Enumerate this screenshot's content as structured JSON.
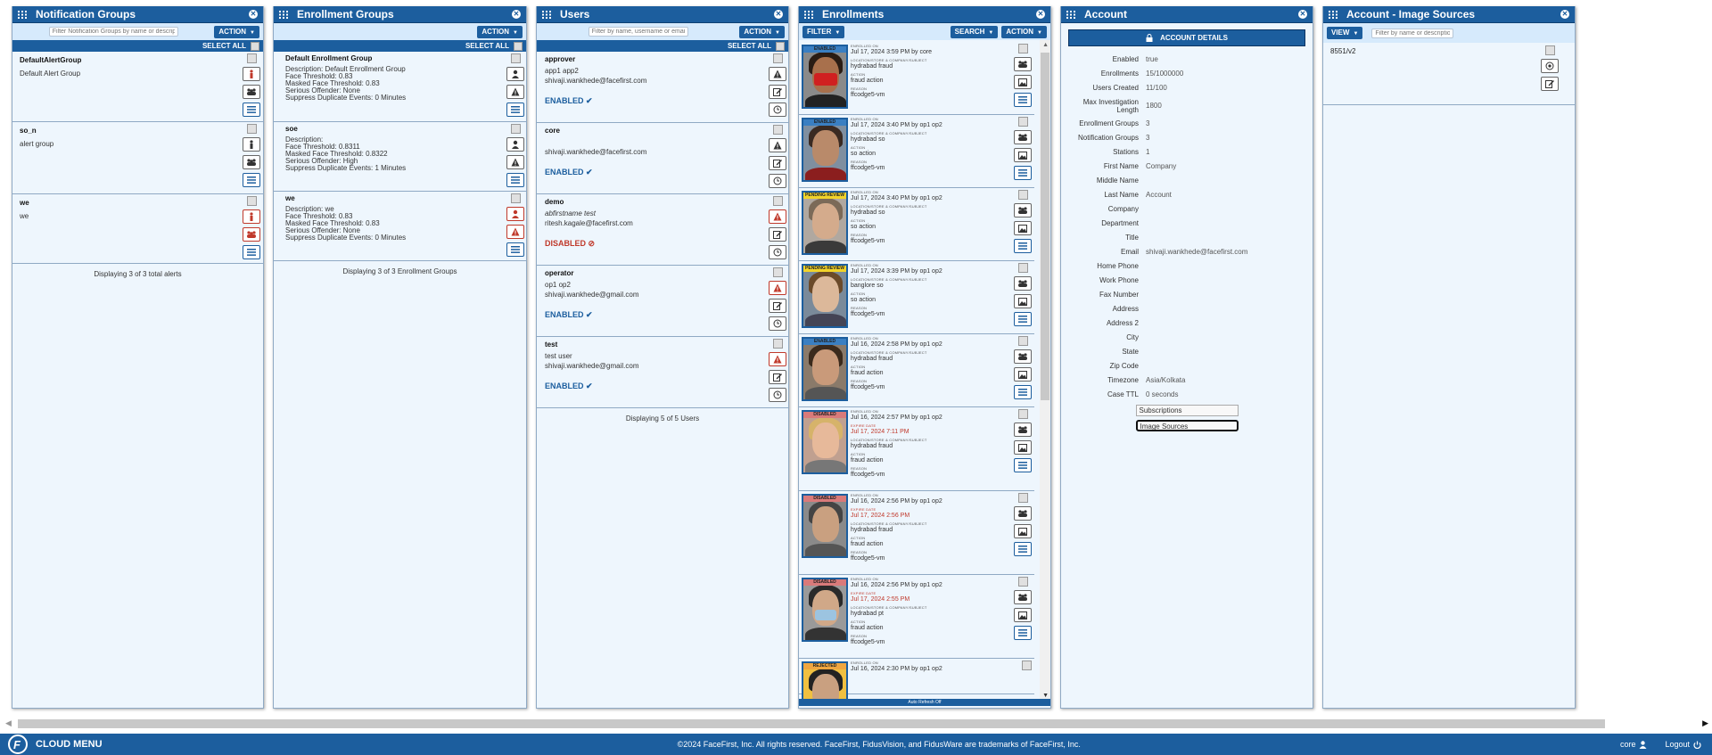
{
  "panels": {
    "notification_groups": {
      "title": "Notification Groups",
      "filter_placeholder": "Filter Notification Groups by name or description",
      "action_label": "ACTION",
      "select_all": "SELECT ALL",
      "items": [
        {
          "name": "DefaultAlertGroup",
          "desc": "Default Alert Group"
        },
        {
          "name": "so_n",
          "desc": "alert group"
        },
        {
          "name": "we",
          "desc": "we"
        }
      ],
      "footer": "Displaying 3 of 3 total alerts"
    },
    "enrollment_groups": {
      "title": "Enrollment Groups",
      "action_label": "ACTION",
      "select_all": "SELECT ALL",
      "items": [
        {
          "name": "Default Enrollment Group",
          "lines": [
            "Description: Default Enrollment Group",
            "Face Threshold: 0.83",
            "Masked Face Threshold: 0.83",
            "Serious Offender: None",
            "Suppress Duplicate Events: 0 Minutes"
          ]
        },
        {
          "name": "soe",
          "lines": [
            "Description:",
            "Face Threshold: 0.8311",
            "Masked Face Threshold: 0.8322",
            "Serious Offender: High",
            "Suppress Duplicate Events: 1 Minutes"
          ]
        },
        {
          "name": "we",
          "lines": [
            "Description: we",
            "Face Threshold: 0.83",
            "Masked Face Threshold: 0.83",
            "Serious Offender: None",
            "Suppress Duplicate Events: 0 Minutes"
          ]
        }
      ],
      "footer": "Displaying 3 of 3 Enrollment Groups"
    },
    "users": {
      "title": "Users",
      "filter_placeholder": "Filter by name, username or email",
      "action_label": "ACTION",
      "select_all": "SELECT ALL",
      "items": [
        {
          "name": "approver",
          "full": "app1 app2",
          "email": "shivaji.wankhede@facefirst.com",
          "status": "ENABLED ✔"
        },
        {
          "name": "core",
          "full": "",
          "email": "shivaji.wankhede@facefirst.com",
          "status": "ENABLED ✔"
        },
        {
          "name": "demo",
          "full": "abfirstname test",
          "email": "ritesh.kagale@facefirst.com",
          "status": "DISABLED ⊘"
        },
        {
          "name": "operator",
          "full": "op1 op2",
          "email": "shivaji.wankhede@gmail.com",
          "status": "ENABLED ✔"
        },
        {
          "name": "test",
          "full": "test user",
          "email": "shivaji.wankhede@gmail.com",
          "status": "ENABLED ✔"
        }
      ],
      "footer": "Displaying 5 of 5 Users"
    },
    "enrollments": {
      "title": "Enrollments",
      "filter_label": "FILTER",
      "search_label": "SEARCH",
      "action_label": "ACTION",
      "label_enrolled": "ENROLLED ON",
      "label_expire": "EXPIRE DATE",
      "label_location": "LOCATION/STORE & COMPANY/SUBJECT",
      "label_action": "ACTION",
      "label_reason": "REASON",
      "auto_refresh": "Auto Refresh Off",
      "items": [
        {
          "status": "ENABLED",
          "enrolled": "Jul 17, 2024 3:59 PM by core",
          "expire": "",
          "location": "hydrabad fraud",
          "action": "fraud action",
          "reason": "ffcodge5-vm"
        },
        {
          "status": "ENABLED",
          "enrolled": "Jul 17, 2024 3:40 PM by op1 op2",
          "expire": "",
          "location": "hydrabad so",
          "action": "so action",
          "reason": "ffcodge5-vm"
        },
        {
          "status": "PENDING REVIEW",
          "enrolled": "Jul 17, 2024 3:40 PM by op1 op2",
          "expire": "",
          "location": "hydrabad so",
          "action": "so action",
          "reason": "ffcodge5-vm"
        },
        {
          "status": "PENDING REVIEW",
          "enrolled": "Jul 17, 2024 3:39 PM by op1 op2",
          "expire": "",
          "location": "banglore so",
          "action": "so action",
          "reason": "ffcodge5-vm"
        },
        {
          "status": "ENABLED",
          "enrolled": "Jul 16, 2024 2:58 PM by op1 op2",
          "expire": "",
          "location": "hydrabad fraud",
          "action": "fraud action",
          "reason": "ffcodge5-vm"
        },
        {
          "status": "DISABLED",
          "enrolled": "Jul 16, 2024 2:57 PM by op1 op2",
          "expire": "Jul 17, 2024 7:11 PM",
          "location": "hydrabad fraud",
          "action": "fraud action",
          "reason": "ffcodge5-vm"
        },
        {
          "status": "DISABLED",
          "enrolled": "Jul 16, 2024 2:56 PM by op1 op2",
          "expire": "Jul 17, 2024 2:56 PM",
          "location": "hydrabad fraud",
          "action": "fraud action",
          "reason": "ffcodge5-vm"
        },
        {
          "status": "DISABLED",
          "enrolled": "Jul 16, 2024 2:56 PM by op1 op2",
          "expire": "Jul 17, 2024 2:55 PM",
          "location": "hydrabad pt",
          "action": "fraud action",
          "reason": "ffcodge5-vm"
        },
        {
          "status": "REJECTED",
          "enrolled": "Jul 16, 2024 2:30 PM by op1 op2",
          "expire": "",
          "location": "",
          "action": "",
          "reason": ""
        }
      ]
    },
    "account": {
      "title": "Account",
      "details_button": "ACCOUNT DETAILS",
      "fields": [
        {
          "k": "Enabled",
          "v": "true"
        },
        {
          "k": "Enrollments",
          "v": "15/1000000"
        },
        {
          "k": "Users Created",
          "v": "11/100"
        },
        {
          "k": "Max Investigation Length",
          "v": "1800"
        },
        {
          "k": "Enrollment Groups",
          "v": "3"
        },
        {
          "k": "Notification Groups",
          "v": "3"
        },
        {
          "k": "Stations",
          "v": "1"
        },
        {
          "k": "First Name",
          "v": "Company"
        },
        {
          "k": "Middle Name",
          "v": ""
        },
        {
          "k": "Last Name",
          "v": "Account"
        },
        {
          "k": "Company",
          "v": ""
        },
        {
          "k": "Department",
          "v": ""
        },
        {
          "k": "Title",
          "v": ""
        },
        {
          "k": "Email",
          "v": "shivaji.wankhede@facefirst.com"
        },
        {
          "k": "Home Phone",
          "v": ""
        },
        {
          "k": "Work Phone",
          "v": ""
        },
        {
          "k": "Fax Number",
          "v": ""
        },
        {
          "k": "Address",
          "v": ""
        },
        {
          "k": "Address 2",
          "v": ""
        },
        {
          "k": "City",
          "v": ""
        },
        {
          "k": "State",
          "v": ""
        },
        {
          "k": "Zip Code",
          "v": ""
        },
        {
          "k": "Timezone",
          "v": "Asia/Kolkata"
        },
        {
          "k": "Case TTL",
          "v": "0 seconds"
        }
      ],
      "subscriptions": "Subscriptions",
      "image_sources": "Image Sources"
    },
    "image_sources": {
      "title": "Account - Image Sources",
      "view_label": "VIEW",
      "filter_placeholder": "Filter by name or description",
      "items": [
        {
          "name": "8551/v2"
        }
      ]
    }
  },
  "footer": {
    "menu": "CLOUD MENU",
    "copyright": "©2024 FaceFirst, Inc. All rights reserved. FaceFirst, FidusVision, and FidusWare are trademarks of FaceFirst, Inc.",
    "user": "core",
    "logout": "Logout"
  },
  "colors": {
    "primary": "#1c5e9e",
    "panel_bg": "#eef6fd",
    "toolbar_bg": "#d6eafc",
    "danger": "#c0392b"
  }
}
